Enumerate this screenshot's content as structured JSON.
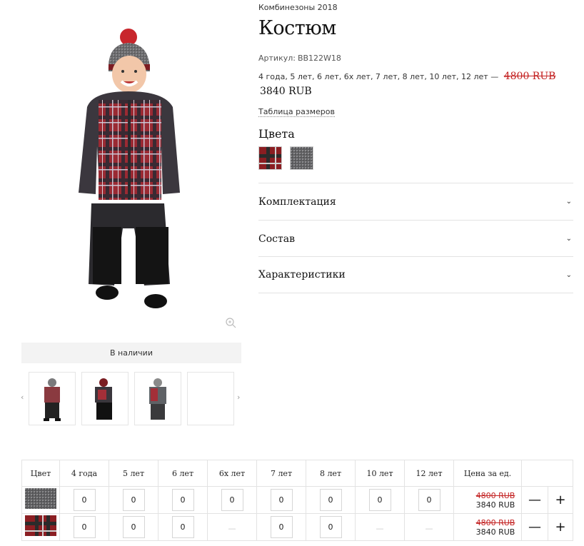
{
  "product": {
    "category": "Комбинезоны 2018",
    "title": "Костюм",
    "sku_label": "Артикул:",
    "sku": "BB122W18",
    "sizes_text": "4 года, 5 лет, 6 лет, 6х лет, 7 лет, 8 лет, 10 лет, 12 лет —",
    "old_price": "4800 RUB",
    "new_price": "3840 RUB",
    "size_table_link": "Таблица размеров",
    "colors_title": "Цвета",
    "availability": "В наличии"
  },
  "accordion": [
    {
      "label": "Комплектация",
      "icon": "chevron-down"
    },
    {
      "label": "Состав",
      "icon": "chevron-down"
    },
    {
      "label": "Характеристики",
      "icon": "chevron-down"
    }
  ],
  "colors": [
    "#8b1e22",
    "#6a6a6a",
    "#2b2b2b"
  ],
  "table": {
    "headers": [
      "Цвет",
      "4 года",
      "5 лет",
      "6 лет",
      "6х лет",
      "7 лет",
      "8 лет",
      "10 лет",
      "12 лет",
      "Цена за ед."
    ],
    "rows": [
      {
        "swatch": "grey",
        "qty": [
          "0",
          "0",
          "0",
          "0",
          "0",
          "0",
          "0",
          "0"
        ],
        "old_price": "4800 RUB",
        "new_price": "3840 RUB",
        "minus": "—",
        "plus": "+"
      },
      {
        "swatch": "red-plaid",
        "qty": [
          "0",
          "0",
          "0",
          "—",
          "0",
          "0",
          "—",
          "—"
        ],
        "old_price": "4800 RUB",
        "new_price": "3840 RUB",
        "minus": "—",
        "plus": "+"
      }
    ]
  },
  "icons": [
    "zoom-icon",
    "chevron-left-icon",
    "chevron-right-icon",
    "chevron-down-icon"
  ],
  "arrows": {
    "left": "‹",
    "right": "›",
    "chev": "⌄"
  }
}
